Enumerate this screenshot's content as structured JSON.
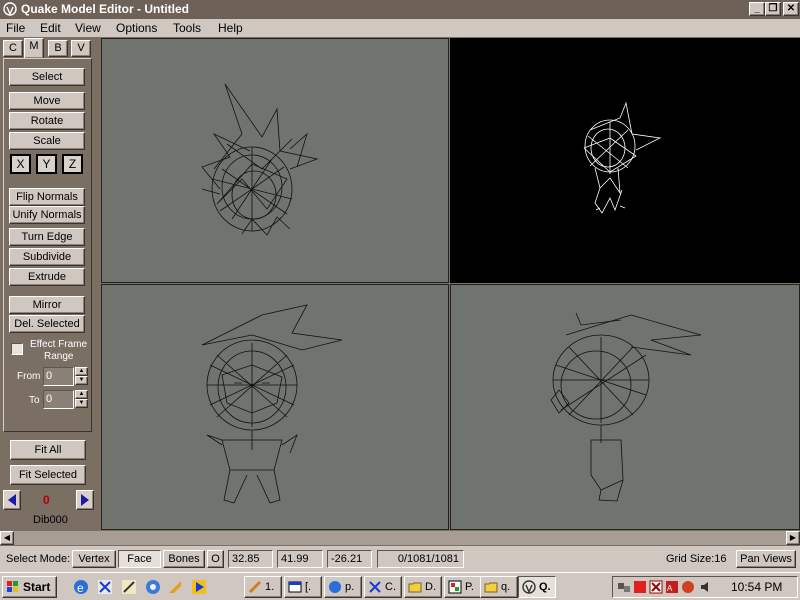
{
  "window": {
    "title": "Quake Model Editor - Untitled",
    "controls": [
      "_",
      "❐",
      "✕"
    ]
  },
  "menu": [
    "File",
    "Edit",
    "View",
    "Options",
    "Tools",
    "Help"
  ],
  "tabs": [
    "C",
    "M",
    "B",
    "V"
  ],
  "active_tab": "M",
  "tools": {
    "select": "Select",
    "move": "Move",
    "rotate": "Rotate",
    "scale": "Scale",
    "axes": [
      "X",
      "Y",
      "Z"
    ],
    "flip_normals": "Flip Normals",
    "unify_normals": "Unify Normals",
    "turn_edge": "Turn Edge",
    "subdivide": "Subdivide",
    "extrude": "Extrude",
    "mirror": "Mirror",
    "delete_selected": "Del. Selected",
    "effect_frame_range_line1": "Effect Frame",
    "effect_frame_range_line2": "Range",
    "from_label": "From",
    "from_value": "0",
    "to_label": "To",
    "to_value": "0"
  },
  "view_buttons": {
    "fit_all": "Fit All",
    "fit_selected": "Fit Selected"
  },
  "frame": {
    "number": "0",
    "name": "Dib000"
  },
  "colors": {
    "viewport_bg": "#6f756e",
    "viewport_3d_bg": "#000000",
    "frame_number": "#b40000",
    "nav_arrow": "#1a1aa8"
  },
  "status": {
    "select_mode_label": "Select Mode:",
    "modes": [
      "Vertex",
      "Face",
      "Bones",
      "O"
    ],
    "active_mode": "Face",
    "coord_x": "32.85",
    "coord_y": "41.99",
    "coord_z": "-26.21",
    "selection": "0/1081/1081",
    "grid_size": "Grid Size:16",
    "pan_views": "Pan Views"
  },
  "taskbar": {
    "start": "Start",
    "tasks": [
      "1.",
      "[.",
      "p.",
      "C.",
      "D.",
      "P.",
      "q.",
      "Q."
    ],
    "clock": "10:54 PM"
  }
}
